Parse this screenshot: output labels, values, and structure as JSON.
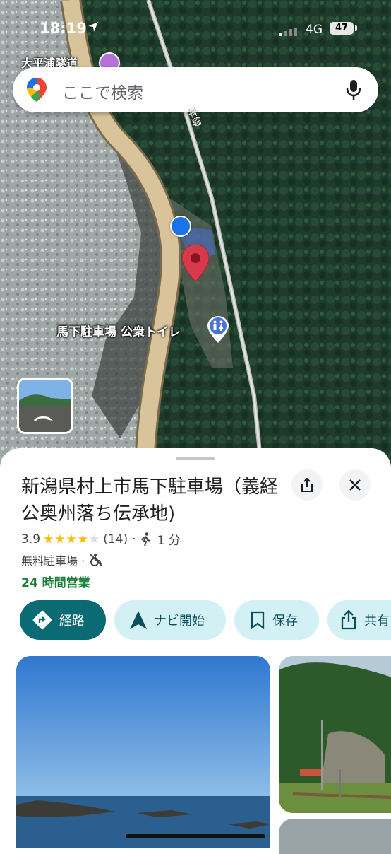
{
  "status_bar": {
    "time": "18:19",
    "network": "4G",
    "battery": "47"
  },
  "map": {
    "top_place_label": "大平浦隧道",
    "road_label": "本線",
    "poi_label": "馬下駐車場 公衆トイレ"
  },
  "search": {
    "placeholder": "ここで検索"
  },
  "place": {
    "title": "新潟県村上市馬下駐車場（義経公奥州落ち伝承地)",
    "rating": "3.9",
    "stars": "★★★★",
    "star_empty": "★",
    "review_count": "(14)",
    "separator": "·",
    "walk_time": "1 分",
    "category": "無料駐車場 ·",
    "hours": "24 時間営業",
    "rating_value": 3.9
  },
  "actions": [
    {
      "label": "経路"
    },
    {
      "label": "ナビ開始"
    },
    {
      "label": "保存"
    },
    {
      "label": "共有"
    }
  ],
  "colors": {
    "primary": "#0b6b74",
    "chip": "#d3f1f4",
    "hours_green": "#188038",
    "star": "#fbbc04"
  }
}
